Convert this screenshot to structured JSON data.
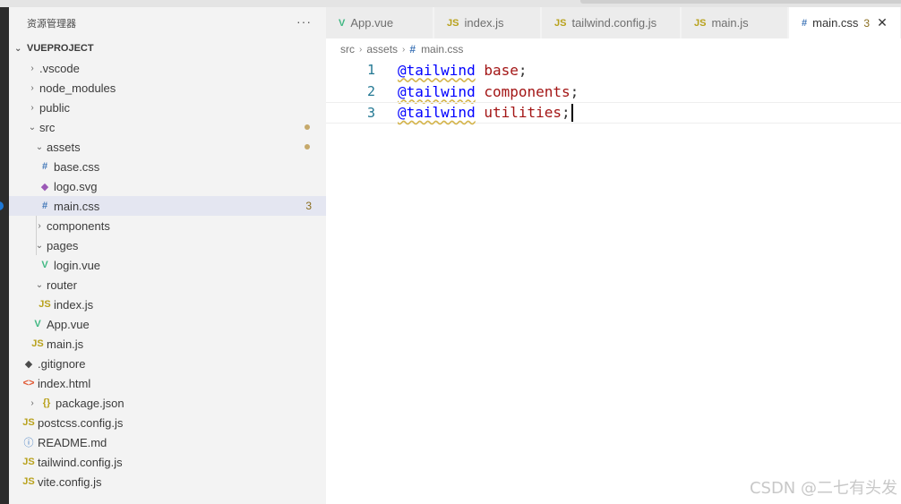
{
  "explorer": {
    "title": "资源管理器",
    "more": "···",
    "root": "VUEPROJECT",
    "items": [
      {
        "label": ".vscode",
        "icon": "chevron-right",
        "badge": ""
      },
      {
        "label": "node_modules",
        "icon": "chevron-right",
        "badge": ""
      },
      {
        "label": "public",
        "icon": "chevron-right",
        "badge": ""
      },
      {
        "label": "src",
        "icon": "chevron-down",
        "badge": ""
      },
      {
        "label": "assets",
        "icon": "chevron-down",
        "badge": ""
      },
      {
        "label": "base.css",
        "icon": "css-file-icon",
        "badge": ""
      },
      {
        "label": "logo.svg",
        "icon": "svg-file-icon",
        "badge": ""
      },
      {
        "label": "main.css",
        "icon": "css-file-icon",
        "badge": "3"
      },
      {
        "label": "components",
        "icon": "chevron-right",
        "badge": ""
      },
      {
        "label": "pages",
        "icon": "chevron-down",
        "badge": ""
      },
      {
        "label": "login.vue",
        "icon": "vue-file-icon",
        "badge": ""
      },
      {
        "label": "router",
        "icon": "chevron-down",
        "badge": ""
      },
      {
        "label": "index.js",
        "icon": "js-file-icon",
        "badge": ""
      },
      {
        "label": "App.vue",
        "icon": "vue-file-icon",
        "badge": ""
      },
      {
        "label": "main.js",
        "icon": "js-file-icon",
        "badge": ""
      },
      {
        "label": ".gitignore",
        "icon": "git-file-icon",
        "badge": ""
      },
      {
        "label": "index.html",
        "icon": "html-file-icon",
        "badge": ""
      },
      {
        "label": "package.json",
        "icon": "json-file-icon",
        "badge": ""
      },
      {
        "label": "postcss.config.js",
        "icon": "js-file-icon",
        "badge": ""
      },
      {
        "label": "README.md",
        "icon": "info-file-icon",
        "badge": ""
      },
      {
        "label": "tailwind.config.js",
        "icon": "js-file-icon",
        "badge": ""
      },
      {
        "label": "vite.config.js",
        "icon": "js-file-icon",
        "badge": ""
      }
    ]
  },
  "tabs": [
    {
      "label": "App.vue",
      "icon": "vue-file-icon",
      "badge": "",
      "active": false
    },
    {
      "label": "index.js",
      "icon": "js-file-icon",
      "badge": "",
      "active": false
    },
    {
      "label": "tailwind.config.js",
      "icon": "js-file-icon",
      "badge": "",
      "active": false
    },
    {
      "label": "main.js",
      "icon": "js-file-icon",
      "badge": "",
      "active": false
    },
    {
      "label": "main.css",
      "icon": "css-file-icon",
      "badge": "3",
      "active": true
    }
  ],
  "breadcrumb": [
    "src",
    "assets",
    "main.css"
  ],
  "editor": {
    "lines": [
      {
        "number": "1",
        "directive": "@tailwind",
        "arg": "base",
        "end": ";"
      },
      {
        "number": "2",
        "directive": "@tailwind",
        "arg": "components",
        "end": ";"
      },
      {
        "number": "3",
        "directive": "@tailwind",
        "arg": "utilities",
        "end": ";"
      }
    ]
  },
  "watermark": "CSDN @二七有头发",
  "icons": {
    "js": "JS",
    "css": "#",
    "vue": "V",
    "svg": "◆",
    "git": "◆",
    "html": "<>",
    "json": "{}",
    "info": "ⓘ",
    "close": "✕",
    "chevron_right": "›",
    "chevron_down": "⌄"
  },
  "colors": {
    "sidebar_bg": "#f3f3f3",
    "selection": "#e4e6f1",
    "directive": "#0000ff",
    "keyword": "#a31515",
    "line_number": "#237893"
  }
}
